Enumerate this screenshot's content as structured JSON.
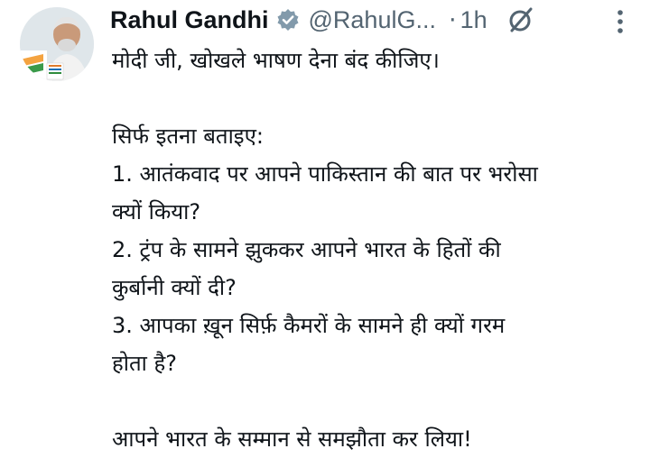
{
  "tweet": {
    "display_name": "Rahul Gandhi",
    "handle": "@RahulG...",
    "separator": "·",
    "time": "1h",
    "lines": [
      "मोदी जी, खोखले भाषण देना बंद कीजिए।",
      "",
      "सिर्फ इतना बताइए:",
      "1. आतंकवाद पर आपने पाकिस्तान की बात पर भरोसा",
      "क्यों किया?",
      "2. ट्रंप के सामने झुककर आपने भारत के हितों की",
      "कुर्बानी क्यों दी?",
      "3. आपका ख़ून सिर्फ़ कैमरों के सामने ही क्यों गरम",
      "होता है?",
      "",
      "आपने भारत के सम्मान से समझौता कर लिया!"
    ]
  },
  "icons": {
    "verified": "verified-badge-icon",
    "grok": "grok-icon",
    "more": "more-options-icon"
  },
  "colors": {
    "text": "#0f1419",
    "secondary": "#536471",
    "verified": "#829aab"
  }
}
